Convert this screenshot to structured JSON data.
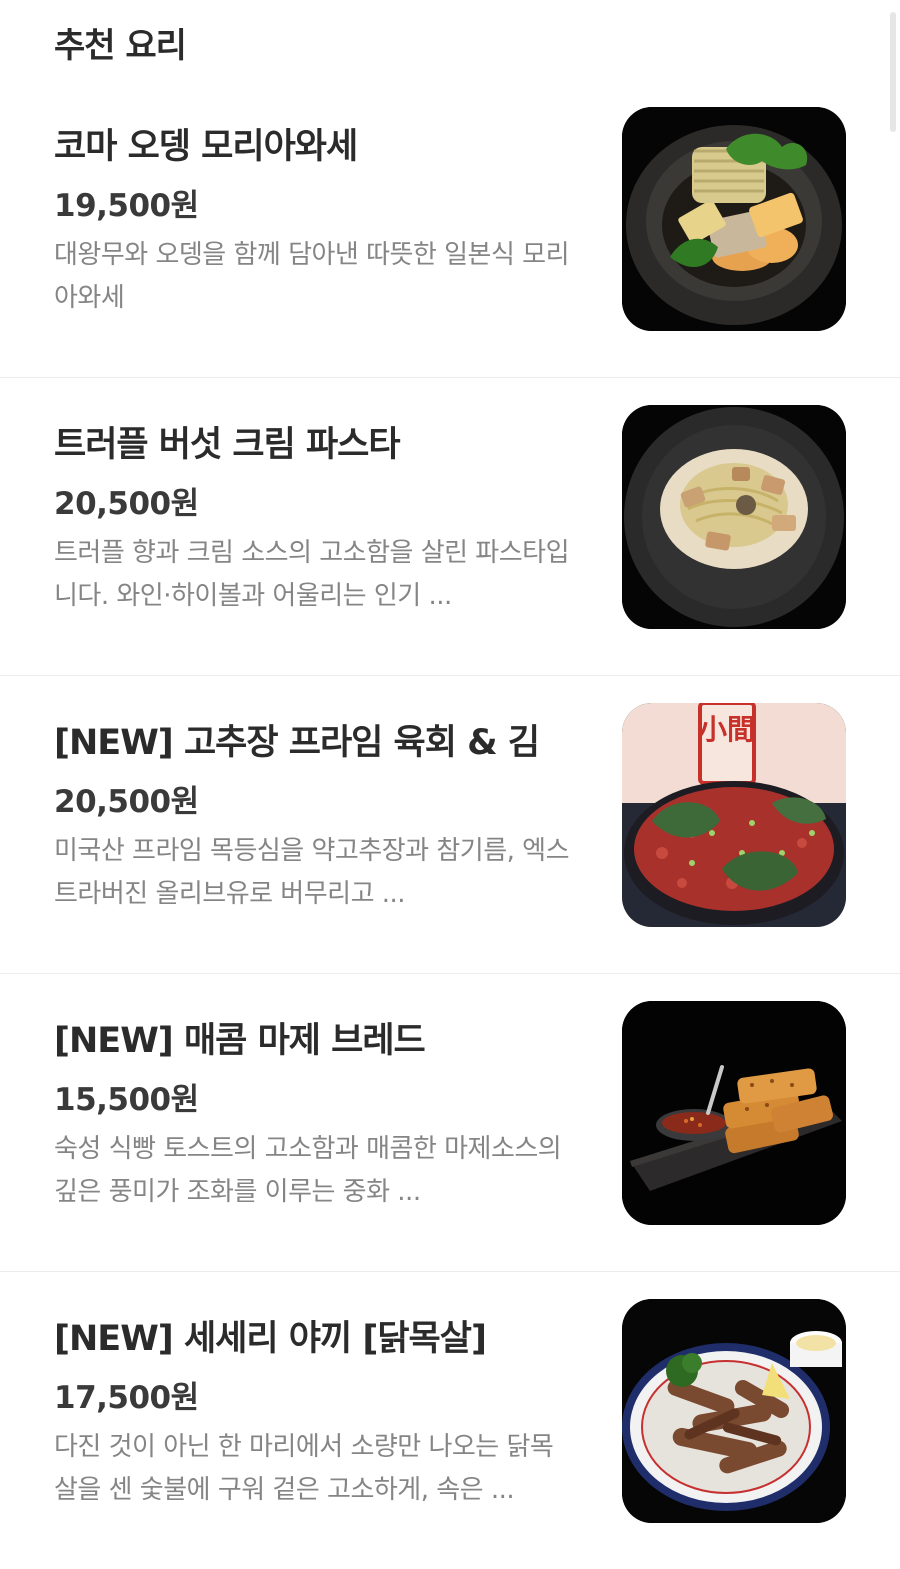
{
  "section": {
    "title": "추천 요리"
  },
  "items": [
    {
      "name": "코마 오뎅 모리아와세",
      "price": "19,500원",
      "description": "대왕무와 오뎅을 함께 담아낸 따뜻한 일본식 모리아와세"
    },
    {
      "name": "트러플 버섯 크림 파스타",
      "price": "20,500원",
      "description": "트러플 향과 크림 소스의 고소함을 살린 파스타입니다. 와인·하이볼과 어울리는 인기 ..."
    },
    {
      "name": "[NEW] 고추장 프라임 육회 & 김",
      "price": "20,500원",
      "description": "미국산 프라임 목등심을 약고추장과 참기름, 엑스트라버진 올리브유로 버무리고 ..."
    },
    {
      "name": "[NEW] 매콤 마제 브레드",
      "price": "15,500원",
      "description": "숙성 식빵 토스트의 고소함과 매콤한 마제소스의 깊은 풍미가 조화를 이루는 중화 ..."
    },
    {
      "name": "[NEW] 세세리 야끼 [닭목살]",
      "price": "17,500원",
      "description": "다진 것이 아닌 한 마리에서 소량만 나오는 닭목살을 센 숯불에 구워 겉은 고소하게, 속은 ..."
    }
  ],
  "images": {
    "sign_text": "小間"
  }
}
